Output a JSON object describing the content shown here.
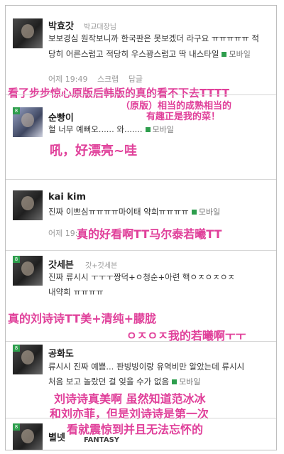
{
  "comments": [
    {
      "nickname": "박효갓",
      "sub_label": "박교대장님",
      "text_lines": [
        "보보경심 원작보니까 한국판은 못보겠더 라구요 ㅠㅠㅠㅠㅠ 적",
        "당히 어른스럽고 적당히 우스꽝스럽고 딱 내스타일"
      ],
      "mobile": "모바일",
      "time": "어제 19:49",
      "scrap": "스크랩",
      "reply": "답글",
      "overlay": [
        "看了步步惊心原版后韩版的真的看不下去TTTT",
        "（原版）相当的成熟相当的",
        "有趣正是我的菜！"
      ]
    },
    {
      "nickname": "순빵이",
      "rank": "8",
      "text_lines": [
        "헐 너무 예뻐오...... 와......."
      ],
      "mobile": "모바일",
      "overlay": [
        "吼，好漂亮~哇"
      ]
    },
    {
      "nickname": "kai kim",
      "text_lines": [
        "진짜 이쁘심ㅠㅠㅠㅠ마이태 약희ㅠㅠㅠㅠ"
      ],
      "mobile": "모바일",
      "time": "어제 19:4",
      "overlay": [
        "真的好看啊TT马尔泰若曦TT"
      ]
    },
    {
      "nickname": "갓세븐",
      "rank": "8",
      "sub_label": "갓+갓세븐",
      "text_lines": [
        "진짜 류시시 ㅜㅜㅜ짱덕+ㅇ청순+아련 핵ㅇㅈㅇㅈㅇㅈ",
        "내약희 ㅠㅠㅠㅠ"
      ],
      "overlay": [
        "真的刘诗诗TT美+清纯+朦胧",
        "ㅇㅈㅇㅈ我的若曦啊ㅜㅜ"
      ]
    },
    {
      "nickname": "공화도",
      "rank": "8",
      "text_lines": [
        "류시시 진짜 예쁨... 판빙빙이랑 유역비만 알았는데 류시시",
        "처음 보고 놀랐던 걸 잊을 수가 없음"
      ],
      "mobile": "모바일",
      "overlay": [
        "刘诗诗真美啊 虽然知道范冰冰",
        "和刘亦菲，但是刘诗诗是第一次",
        "看就震惊到并且无法忘怀的"
      ]
    },
    {
      "nickname": "별넷",
      "rank": "8",
      "logo": "FANTASY"
    }
  ]
}
